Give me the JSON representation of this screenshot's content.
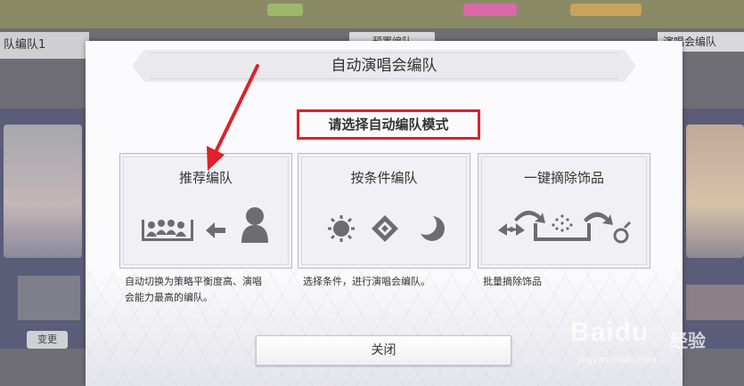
{
  "background": {
    "left_header": "队编队1",
    "left_button": "预置编队",
    "right_header": "演唱会编队",
    "left_bottom_button": "变更"
  },
  "dialog": {
    "title": "自动演唱会编队",
    "prompt": "请选择自动编队模式",
    "options": [
      {
        "title": "推荐编队",
        "description_line1": "自动切换为策略平衡度高、演唱",
        "description_line2": "会能力最高的编队。",
        "icon": "team-recommend-icon"
      },
      {
        "title": "按条件编队",
        "description_line1": "选择条件，进行演唱会编队。",
        "description_line2": "",
        "icon": "attribute-filter-icon"
      },
      {
        "title": "一键摘除饰品",
        "description_line1": "批量摘除饰品",
        "description_line2": "",
        "icon": "remove-accessories-icon"
      }
    ],
    "close_label": "关闭"
  },
  "annotation": {
    "highlight_color": "#e0202a"
  },
  "watermark": {
    "brand": "Baidu",
    "sub": "经验",
    "url": "jingyan.baidu.com"
  }
}
